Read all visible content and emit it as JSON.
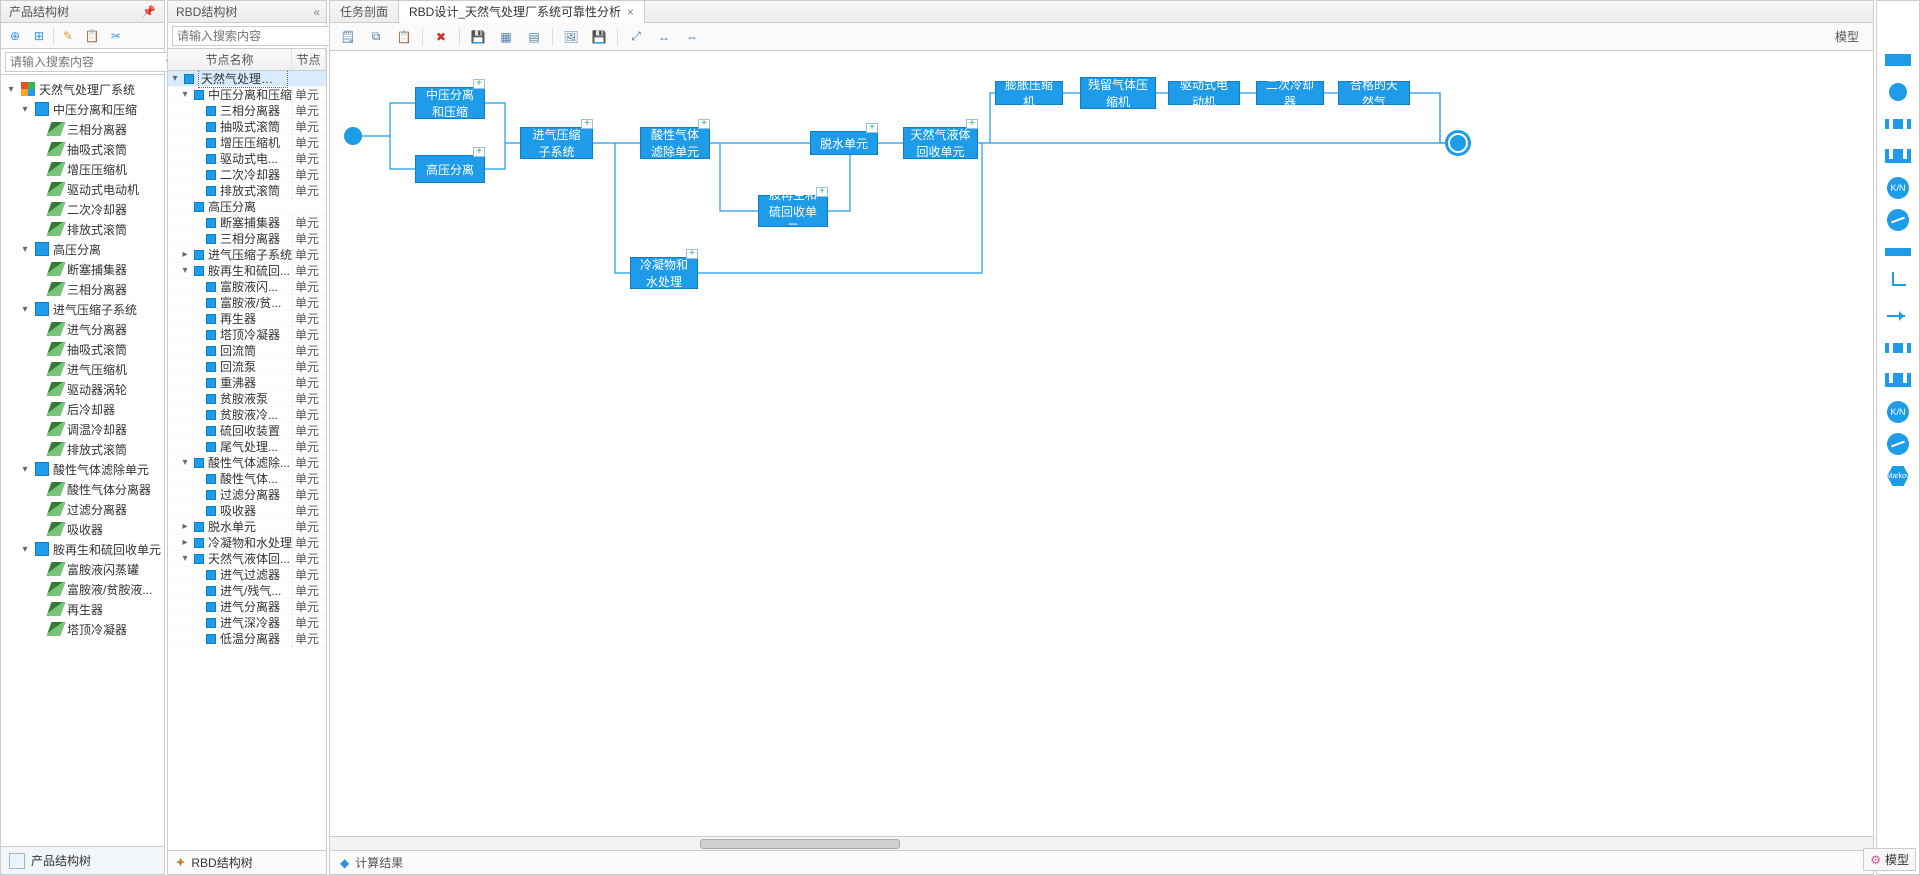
{
  "left": {
    "title": "产品结构树",
    "search_placeholder": "请输入搜索内容",
    "footer": "产品结构树",
    "tree": [
      {
        "ind": 0,
        "tw": "▾",
        "ic": "root-ic",
        "lbl": "天然气处理厂系统"
      },
      {
        "ind": 1,
        "tw": "▾",
        "ic": "box-ic",
        "lbl": "中压分离和压缩"
      },
      {
        "ind": 2,
        "tw": "",
        "ic": "leaf-ic",
        "lbl": "三相分离器"
      },
      {
        "ind": 2,
        "tw": "",
        "ic": "leaf-ic",
        "lbl": "抽吸式滚筒"
      },
      {
        "ind": 2,
        "tw": "",
        "ic": "leaf-ic",
        "lbl": "增压压缩机"
      },
      {
        "ind": 2,
        "tw": "",
        "ic": "leaf-ic",
        "lbl": "驱动式电动机"
      },
      {
        "ind": 2,
        "tw": "",
        "ic": "leaf-ic",
        "lbl": "二次冷却器"
      },
      {
        "ind": 2,
        "tw": "",
        "ic": "leaf-ic",
        "lbl": "排放式滚筒"
      },
      {
        "ind": 1,
        "tw": "▾",
        "ic": "box-ic",
        "lbl": "高压分离"
      },
      {
        "ind": 2,
        "tw": "",
        "ic": "leaf-ic",
        "lbl": "断塞捕集器"
      },
      {
        "ind": 2,
        "tw": "",
        "ic": "leaf-ic",
        "lbl": "三相分离器"
      },
      {
        "ind": 1,
        "tw": "▾",
        "ic": "box-ic",
        "lbl": "进气压缩子系统"
      },
      {
        "ind": 2,
        "tw": "",
        "ic": "leaf-ic",
        "lbl": "进气分离器"
      },
      {
        "ind": 2,
        "tw": "",
        "ic": "leaf-ic",
        "lbl": "抽吸式滚筒"
      },
      {
        "ind": 2,
        "tw": "",
        "ic": "leaf-ic",
        "lbl": "进气压缩机"
      },
      {
        "ind": 2,
        "tw": "",
        "ic": "leaf-ic",
        "lbl": "驱动器涡轮"
      },
      {
        "ind": 2,
        "tw": "",
        "ic": "leaf-ic",
        "lbl": "后冷却器"
      },
      {
        "ind": 2,
        "tw": "",
        "ic": "leaf-ic",
        "lbl": "调温冷却器"
      },
      {
        "ind": 2,
        "tw": "",
        "ic": "leaf-ic",
        "lbl": "排放式滚筒"
      },
      {
        "ind": 1,
        "tw": "▾",
        "ic": "box-ic",
        "lbl": "酸性气体滤除单元"
      },
      {
        "ind": 2,
        "tw": "",
        "ic": "leaf-ic",
        "lbl": "酸性气体分离器"
      },
      {
        "ind": 2,
        "tw": "",
        "ic": "leaf-ic",
        "lbl": "过滤分离器"
      },
      {
        "ind": 2,
        "tw": "",
        "ic": "leaf-ic",
        "lbl": "吸收器"
      },
      {
        "ind": 1,
        "tw": "▾",
        "ic": "box-ic",
        "lbl": "胺再生和硫回收单元"
      },
      {
        "ind": 2,
        "tw": "",
        "ic": "leaf-ic",
        "lbl": "富胺液闪蒸罐"
      },
      {
        "ind": 2,
        "tw": "",
        "ic": "leaf-ic",
        "lbl": "富胺液/贫胺液..."
      },
      {
        "ind": 2,
        "tw": "",
        "ic": "leaf-ic",
        "lbl": "再生器"
      },
      {
        "ind": 2,
        "tw": "",
        "ic": "leaf-ic",
        "lbl": "塔顶冷凝器"
      }
    ]
  },
  "mid": {
    "title": "RBD结构树",
    "search_placeholder": "请输入搜索内容",
    "footer": "RBD结构树",
    "col_name": "节点名称",
    "col_type": "节点",
    "rows": [
      {
        "ind": 0,
        "tw": "▾",
        "name": "天然气处理厂系...",
        "type": "",
        "sel": true
      },
      {
        "ind": 1,
        "tw": "▾",
        "name": "中压分离和压缩",
        "type": "单元"
      },
      {
        "ind": 2,
        "tw": "",
        "name": "三相分离器",
        "type": "单元"
      },
      {
        "ind": 2,
        "tw": "",
        "name": "抽吸式滚筒",
        "type": "单元"
      },
      {
        "ind": 2,
        "tw": "",
        "name": "增压压缩机",
        "type": "单元"
      },
      {
        "ind": 2,
        "tw": "",
        "name": "驱动式电...",
        "type": "单元"
      },
      {
        "ind": 2,
        "tw": "",
        "name": "二次冷却器",
        "type": "单元"
      },
      {
        "ind": 2,
        "tw": "",
        "name": "排放式滚筒",
        "type": "单元"
      },
      {
        "ind": 1,
        "tw": "",
        "name": "高压分离",
        "type": ""
      },
      {
        "ind": 2,
        "tw": "",
        "name": "断塞捕集器",
        "type": "单元"
      },
      {
        "ind": 2,
        "tw": "",
        "name": "三相分离器",
        "type": "单元"
      },
      {
        "ind": 1,
        "tw": "▸",
        "name": "进气压缩子系统",
        "type": "单元"
      },
      {
        "ind": 1,
        "tw": "▾",
        "name": "胺再生和硫回...",
        "type": "单元"
      },
      {
        "ind": 2,
        "tw": "",
        "name": "富胺液闪...",
        "type": "单元"
      },
      {
        "ind": 2,
        "tw": "",
        "name": "富胺液/贫...",
        "type": "单元"
      },
      {
        "ind": 2,
        "tw": "",
        "name": "再生器",
        "type": "单元"
      },
      {
        "ind": 2,
        "tw": "",
        "name": "塔顶冷凝器",
        "type": "单元"
      },
      {
        "ind": 2,
        "tw": "",
        "name": "回流筒",
        "type": "单元"
      },
      {
        "ind": 2,
        "tw": "",
        "name": "回流泵",
        "type": "单元"
      },
      {
        "ind": 2,
        "tw": "",
        "name": "重沸器",
        "type": "单元"
      },
      {
        "ind": 2,
        "tw": "",
        "name": "贫胺液泵",
        "type": "单元"
      },
      {
        "ind": 2,
        "tw": "",
        "name": "贫胺液冷...",
        "type": "单元"
      },
      {
        "ind": 2,
        "tw": "",
        "name": "硫回收装置",
        "type": "单元"
      },
      {
        "ind": 2,
        "tw": "",
        "name": "尾气处理...",
        "type": "单元"
      },
      {
        "ind": 1,
        "tw": "▾",
        "name": "酸性气体滤除...",
        "type": "单元"
      },
      {
        "ind": 2,
        "tw": "",
        "name": "酸性气体...",
        "type": "单元"
      },
      {
        "ind": 2,
        "tw": "",
        "name": "过滤分离器",
        "type": "单元"
      },
      {
        "ind": 2,
        "tw": "",
        "name": "吸收器",
        "type": "单元"
      },
      {
        "ind": 1,
        "tw": "▸",
        "name": "脱水单元",
        "type": "单元"
      },
      {
        "ind": 1,
        "tw": "▸",
        "name": "冷凝物和水处理",
        "type": "单元"
      },
      {
        "ind": 1,
        "tw": "▾",
        "name": "天然气液体回...",
        "type": "单元"
      },
      {
        "ind": 2,
        "tw": "",
        "name": "进气过滤器",
        "type": "单元"
      },
      {
        "ind": 2,
        "tw": "",
        "name": "进气/残气...",
        "type": "单元"
      },
      {
        "ind": 2,
        "tw": "",
        "name": "进气分离器",
        "type": "单元"
      },
      {
        "ind": 2,
        "tw": "",
        "name": "进气深冷器",
        "type": "单元"
      },
      {
        "ind": 2,
        "tw": "",
        "name": "低温分离器",
        "type": "单元"
      }
    ]
  },
  "main": {
    "tab_inactive": "任务剖面",
    "tab_active": "RBD设计_天然气处理厂系统可靠性分析",
    "toolbar_right": "模型",
    "footer": "计算结果",
    "nodes": {
      "n1": "中压分离和压缩",
      "n2": "高压分离",
      "n3": "进气压缩子系统",
      "n4": "酸性气体滤除单元",
      "n5": "胺再生和硫回收单元",
      "n6": "冷凝物和水处理",
      "n7": "脱水单元",
      "n8": "天然气液体回收单元",
      "n9": "膨胀压缩机",
      "n10": "残留气体压缩机",
      "n11": "驱动式电动机",
      "n12": "二次冷却器",
      "n13": "合格的天然气"
    }
  },
  "right": {
    "kn": "K/N",
    "markov": "Markov",
    "footer": "模型"
  }
}
